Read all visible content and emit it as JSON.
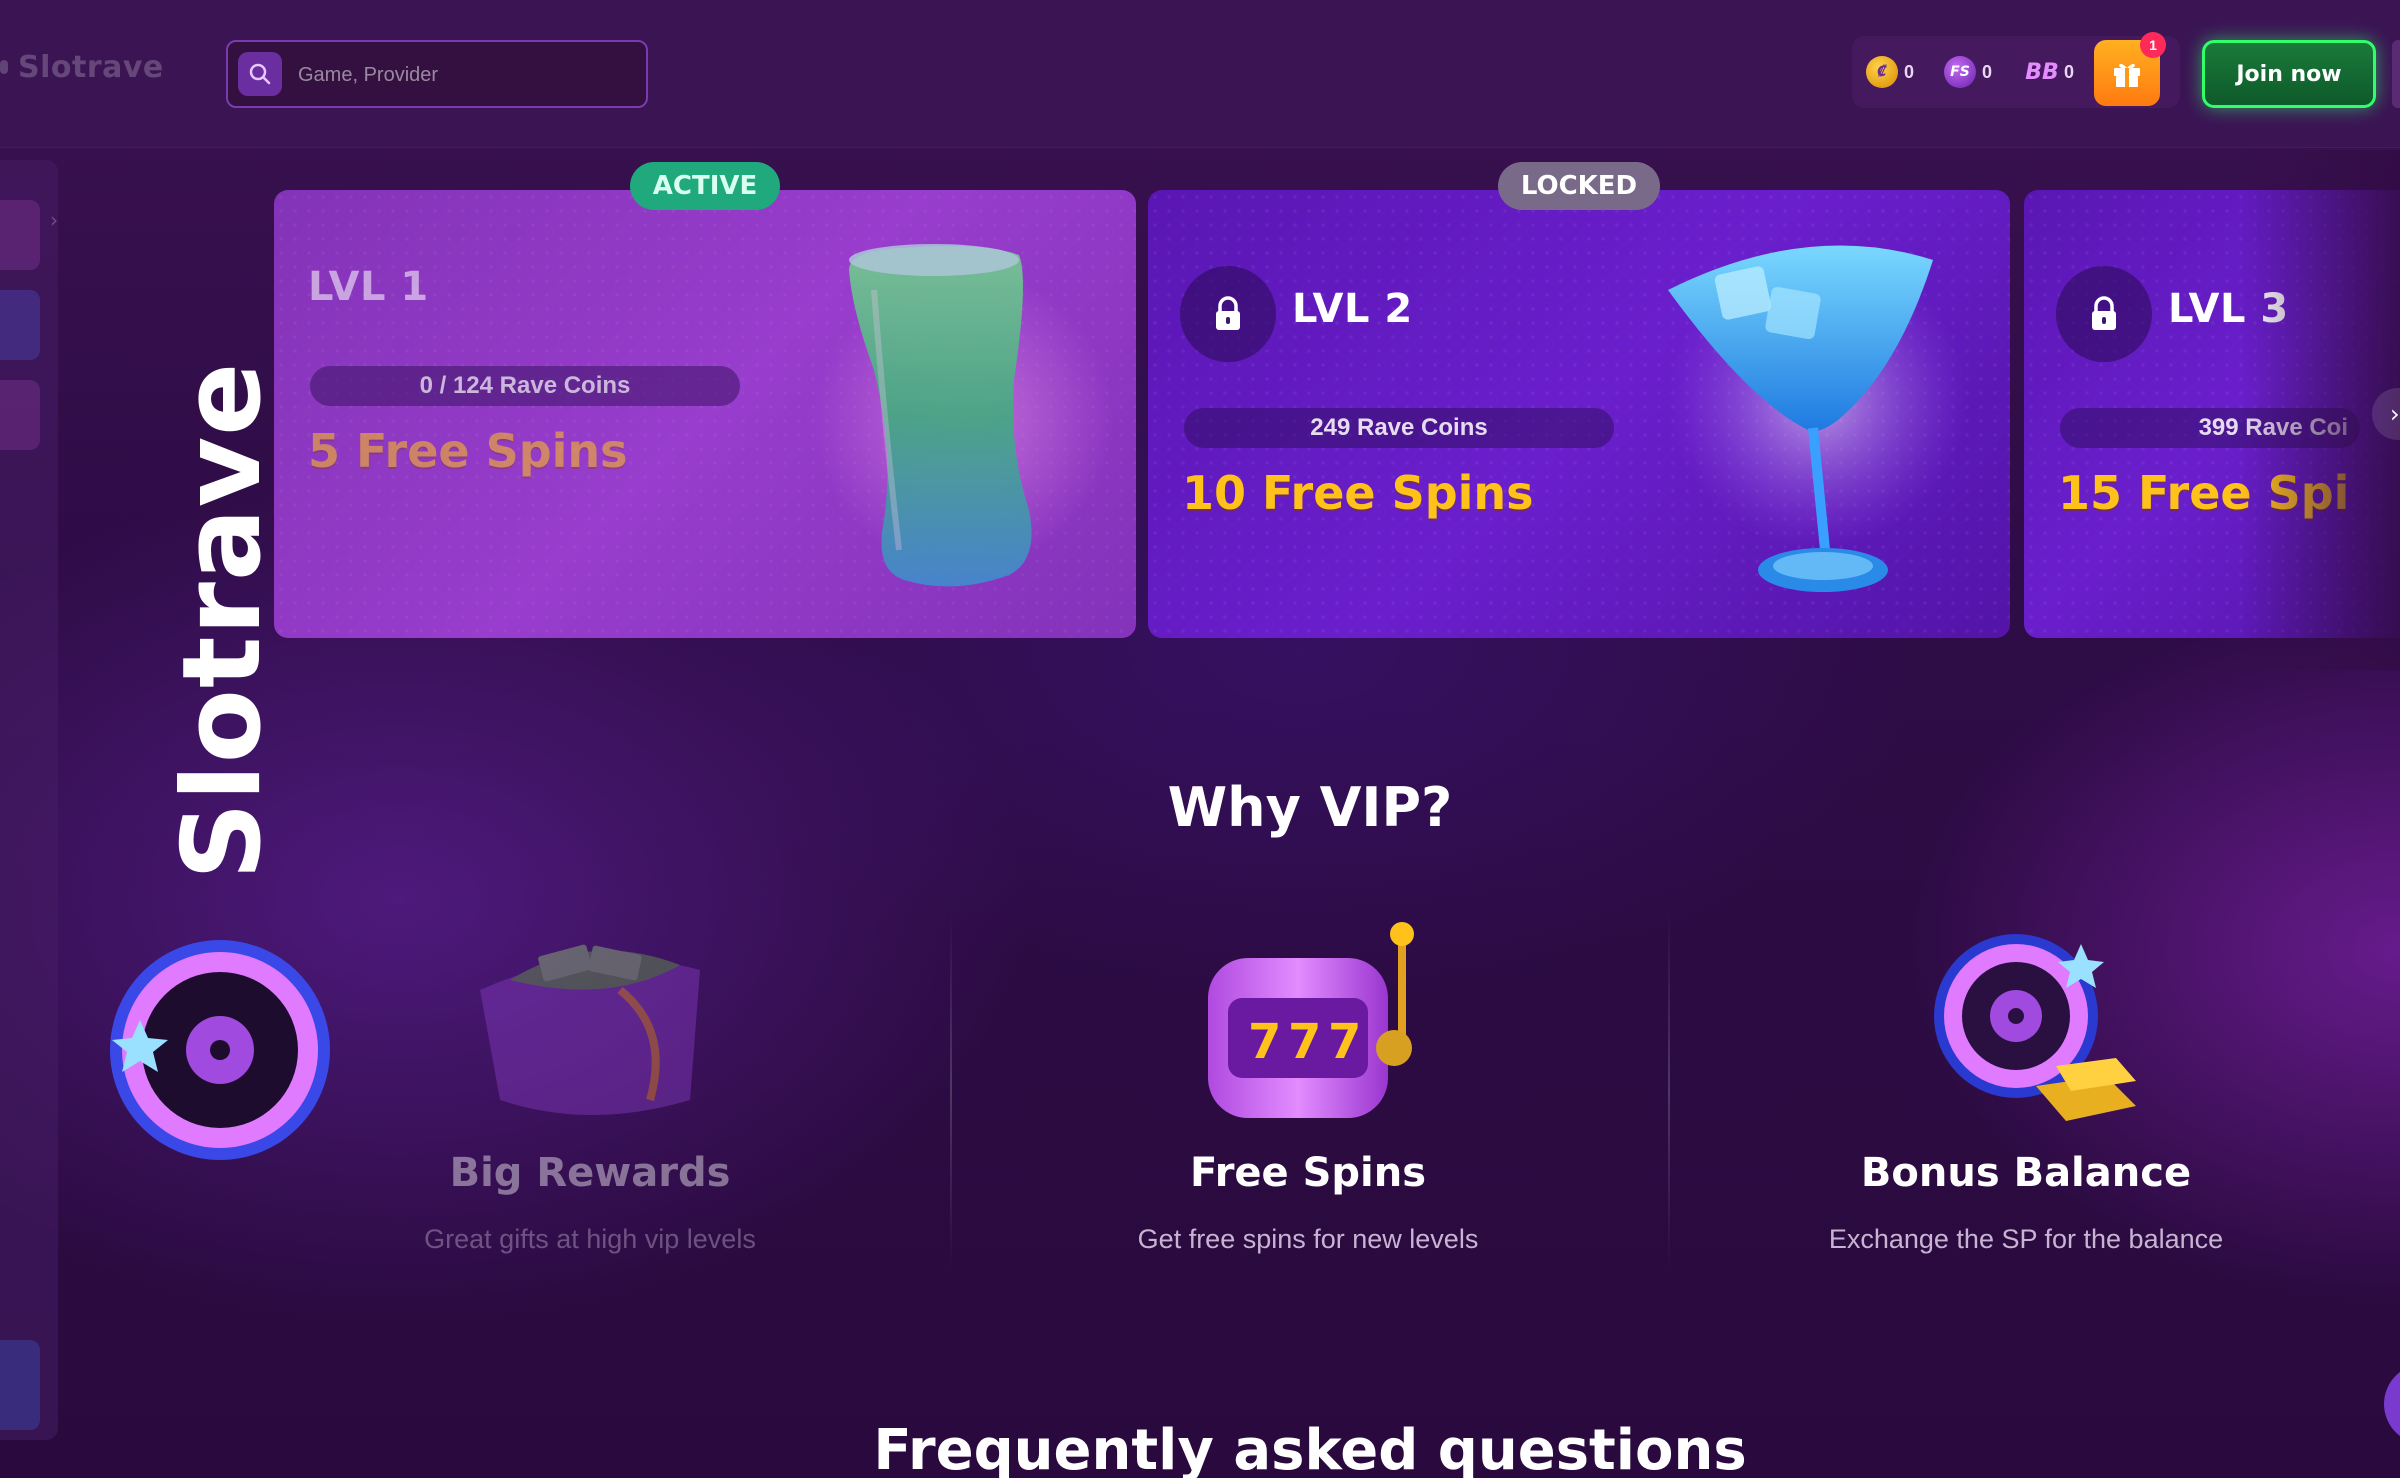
{
  "header": {
    "logo_text": "Slotrave",
    "search": {
      "placeholder": "Game, Provider"
    },
    "balances": [
      {
        "icon": "rave-coin-icon",
        "value": "0"
      },
      {
        "icon": "free-spins-icon",
        "icon_text": "FS",
        "value": "0"
      },
      {
        "icon": "bonus-balance-icon",
        "icon_text": "BB",
        "value": "0"
      }
    ],
    "gift_badge": "1",
    "join_label": "Join now"
  },
  "levels": [
    {
      "status": "ACTIVE",
      "title": "LVL 1",
      "coins": "0 / 124 Rave Coins",
      "reward": "5 Free Spins",
      "locked": false
    },
    {
      "status": "LOCKED",
      "title": "LVL 2",
      "coins": "249 Rave Coins",
      "reward": "10 Free Spins",
      "locked": true
    },
    {
      "title": "LVL 3",
      "coins": "399 Rave Coi",
      "reward": "15 Free Spi",
      "locked": true
    }
  ],
  "why_vip": {
    "title": "Why VIP?",
    "features": [
      {
        "title": "Big Rewards",
        "description": "Great gifts at high vip levels"
      },
      {
        "title": "Free Spins",
        "description": "Get free spins for new levels"
      },
      {
        "title": "Bonus Balance",
        "description": "Exchange the SP for the balance"
      }
    ]
  },
  "faq": {
    "title": "Frequently asked questions"
  },
  "watermark": {
    "text": "Slotrave"
  },
  "colors": {
    "accent_green": "#30ff6a",
    "reward_gold": "#ffc21a",
    "active_badge": "#1fa97c",
    "card_purple": "#8a28d4"
  }
}
